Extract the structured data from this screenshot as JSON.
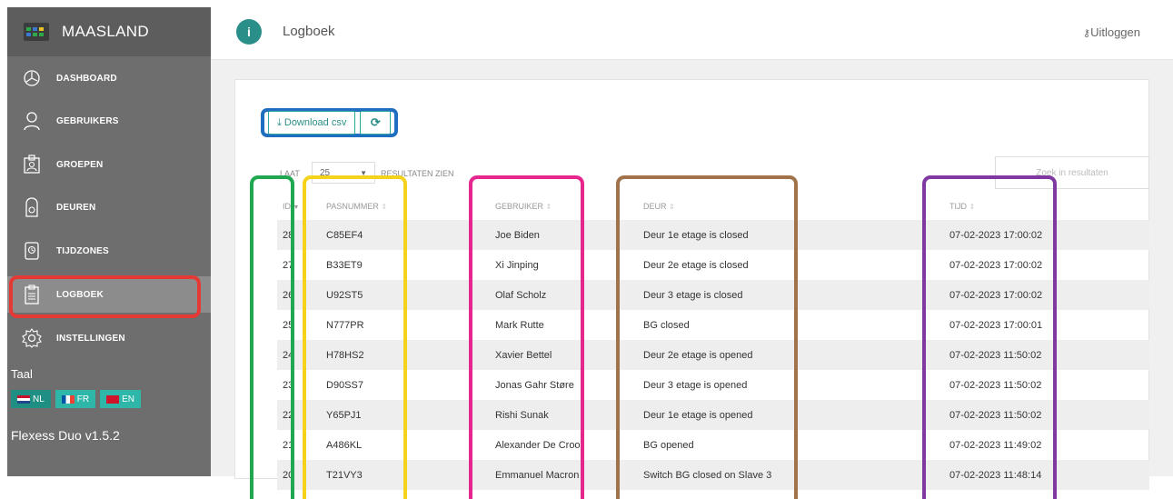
{
  "sidebar": {
    "brand": "MAASLAND",
    "items": [
      {
        "label": "DASHBOARD",
        "icon": "dashboard-icon"
      },
      {
        "label": "GEBRUIKERS",
        "icon": "user-icon"
      },
      {
        "label": "GROEPEN",
        "icon": "group-badge-icon"
      },
      {
        "label": "DEUREN",
        "icon": "door-icon"
      },
      {
        "label": "TIJDZONES",
        "icon": "clock-icon"
      },
      {
        "label": "LOGBOEK",
        "icon": "clipboard-icon",
        "active": true
      },
      {
        "label": "INSTELLINGEN",
        "icon": "gear-icon"
      }
    ],
    "language_label": "Taal",
    "languages": [
      {
        "code": "NL",
        "active": true
      },
      {
        "code": "FR",
        "active": false
      },
      {
        "code": "EN",
        "active": false
      }
    ],
    "version": "Flexess Duo v1.5.2"
  },
  "header": {
    "icon_glyph": "i",
    "title": "Logboek",
    "logout": "Uitloggen"
  },
  "toolbar": {
    "download_label": "Download csv",
    "refresh_glyph": "⟳"
  },
  "table_controls": {
    "show_prefix": "LAAT",
    "page_size": "25",
    "show_suffix": "RESULTATEN ZIEN",
    "search_placeholder": "Zoek in resultaten"
  },
  "table": {
    "headers": [
      "ID",
      "PASNUMMER",
      "GEBRUIKER",
      "DEUR",
      "TIJD"
    ],
    "rows": [
      [
        "28",
        "C85EF4",
        "Joe Biden",
        "Deur 1e etage is closed",
        "07-02-2023 17:00:02"
      ],
      [
        "27",
        "B33ET9",
        "Xi Jinping",
        "Deur 2e etage is closed",
        "07-02-2023 17:00:02"
      ],
      [
        "26",
        "U92ST5",
        "Olaf Scholz",
        "Deur 3 etage is closed",
        "07-02-2023 17:00:02"
      ],
      [
        "25",
        "N777PR",
        "Mark Rutte",
        "BG closed",
        "07-02-2023 17:00:01"
      ],
      [
        "24",
        "H78HS2",
        "Xavier Bettel",
        "Deur 2e etage is opened",
        "07-02-2023 11:50:02"
      ],
      [
        "23",
        "D90SS7",
        "Jonas Gahr Støre",
        "Deur 3 etage is opened",
        "07-02-2023 11:50:02"
      ],
      [
        "22",
        "Y65PJ1",
        "Rishi Sunak",
        "Deur 1e etage is opened",
        "07-02-2023 11:50:02"
      ],
      [
        "21",
        "A486KL",
        "Alexander De Croo",
        "BG opened",
        "07-02-2023 11:49:02"
      ],
      [
        "20",
        "T21VY3",
        "Emmanuel Macron",
        "Switch BG closed on Slave 3",
        "07-02-2023 11:48:14"
      ]
    ]
  },
  "colors": {
    "sidebar_bg": "#6e6e6e",
    "accent": "#2eb7a9",
    "highlight_active_nav": "#e53935",
    "highlight_toolbar": "#1f6ec0",
    "highlight_id": "#1fa84f",
    "highlight_pasnummer": "#f5d21c",
    "highlight_gebruiker": "#e6268f",
    "highlight_deur": "#a0734a",
    "highlight_tijd": "#7e3aa0"
  }
}
